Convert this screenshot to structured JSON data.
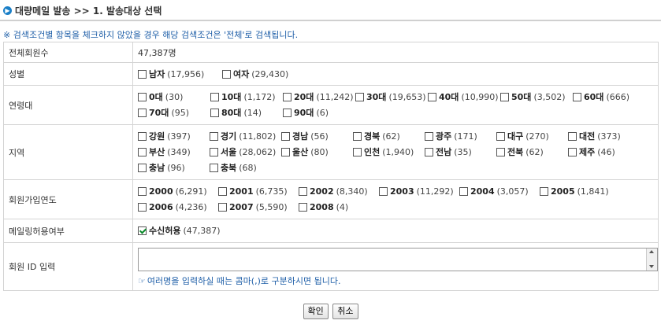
{
  "header": {
    "title": "대량메일 발송 >> 1. 발송대상 선택"
  },
  "notice": "※ 검색조건별 항목을 체크하지 않았을 경우 해당 검색조건은 '전체'로 검색됩니다.",
  "total": {
    "label": "전체회원수",
    "value": "47,387명"
  },
  "gender": {
    "label": "성별",
    "options": [
      {
        "name": "남자",
        "count": "(17,956)",
        "checked": false
      },
      {
        "name": "여자",
        "count": "(29,430)",
        "checked": false
      }
    ]
  },
  "age": {
    "label": "연령대",
    "options": [
      {
        "name": "0대",
        "count": "(30)",
        "checked": false
      },
      {
        "name": "10대",
        "count": "(1,172)",
        "checked": false
      },
      {
        "name": "20대",
        "count": "(11,242)",
        "checked": false
      },
      {
        "name": "30대",
        "count": "(19,653)",
        "checked": false
      },
      {
        "name": "40대",
        "count": "(10,990)",
        "checked": false
      },
      {
        "name": "50대",
        "count": "(3,502)",
        "checked": false
      },
      {
        "name": "60대",
        "count": "(666)",
        "checked": false
      },
      {
        "name": "70대",
        "count": "(95)",
        "checked": false
      },
      {
        "name": "80대",
        "count": "(14)",
        "checked": false
      },
      {
        "name": "90대",
        "count": "(6)",
        "checked": false
      }
    ]
  },
  "region": {
    "label": "지역",
    "options": [
      {
        "name": "강원",
        "count": "(397)",
        "checked": false
      },
      {
        "name": "경기",
        "count": "(11,802)",
        "checked": false
      },
      {
        "name": "경남",
        "count": "(56)",
        "checked": false
      },
      {
        "name": "경북",
        "count": "(62)",
        "checked": false
      },
      {
        "name": "광주",
        "count": "(171)",
        "checked": false
      },
      {
        "name": "대구",
        "count": "(270)",
        "checked": false
      },
      {
        "name": "대전",
        "count": "(373)",
        "checked": false
      },
      {
        "name": "부산",
        "count": "(349)",
        "checked": false
      },
      {
        "name": "서울",
        "count": "(28,062)",
        "checked": false
      },
      {
        "name": "울산",
        "count": "(80)",
        "checked": false
      },
      {
        "name": "인천",
        "count": "(1,940)",
        "checked": false
      },
      {
        "name": "전남",
        "count": "(35)",
        "checked": false
      },
      {
        "name": "전북",
        "count": "(62)",
        "checked": false
      },
      {
        "name": "제주",
        "count": "(46)",
        "checked": false
      },
      {
        "name": "충남",
        "count": "(96)",
        "checked": false
      },
      {
        "name": "충북",
        "count": "(68)",
        "checked": false
      }
    ]
  },
  "join_year": {
    "label": "회원가입연도",
    "options": [
      {
        "name": "2000",
        "count": "(6,291)",
        "checked": false
      },
      {
        "name": "2001",
        "count": "(6,735)",
        "checked": false
      },
      {
        "name": "2002",
        "count": "(8,340)",
        "checked": false
      },
      {
        "name": "2003",
        "count": "(11,292)",
        "checked": false
      },
      {
        "name": "2004",
        "count": "(3,057)",
        "checked": false
      },
      {
        "name": "2005",
        "count": "(1,841)",
        "checked": false
      },
      {
        "name": "2006",
        "count": "(4,236)",
        "checked": false
      },
      {
        "name": "2007",
        "count": "(5,590)",
        "checked": false
      },
      {
        "name": "2008",
        "count": "(4)",
        "checked": false
      }
    ]
  },
  "mailing": {
    "label": "메일링허용여부",
    "options": [
      {
        "name": "수신허용",
        "count": "(47,387)",
        "checked": true
      }
    ]
  },
  "member_id": {
    "label": "회원 ID 입력",
    "value": "",
    "hint": "여러명을 입력하실 때는 콤마(,)로 구분하시면 됩니다."
  },
  "buttons": {
    "confirm": "확인",
    "cancel": "취소"
  },
  "colors": {
    "accent": "#1a7fc7",
    "notice": "#1f5fa8",
    "border": "#d4d4d4"
  }
}
